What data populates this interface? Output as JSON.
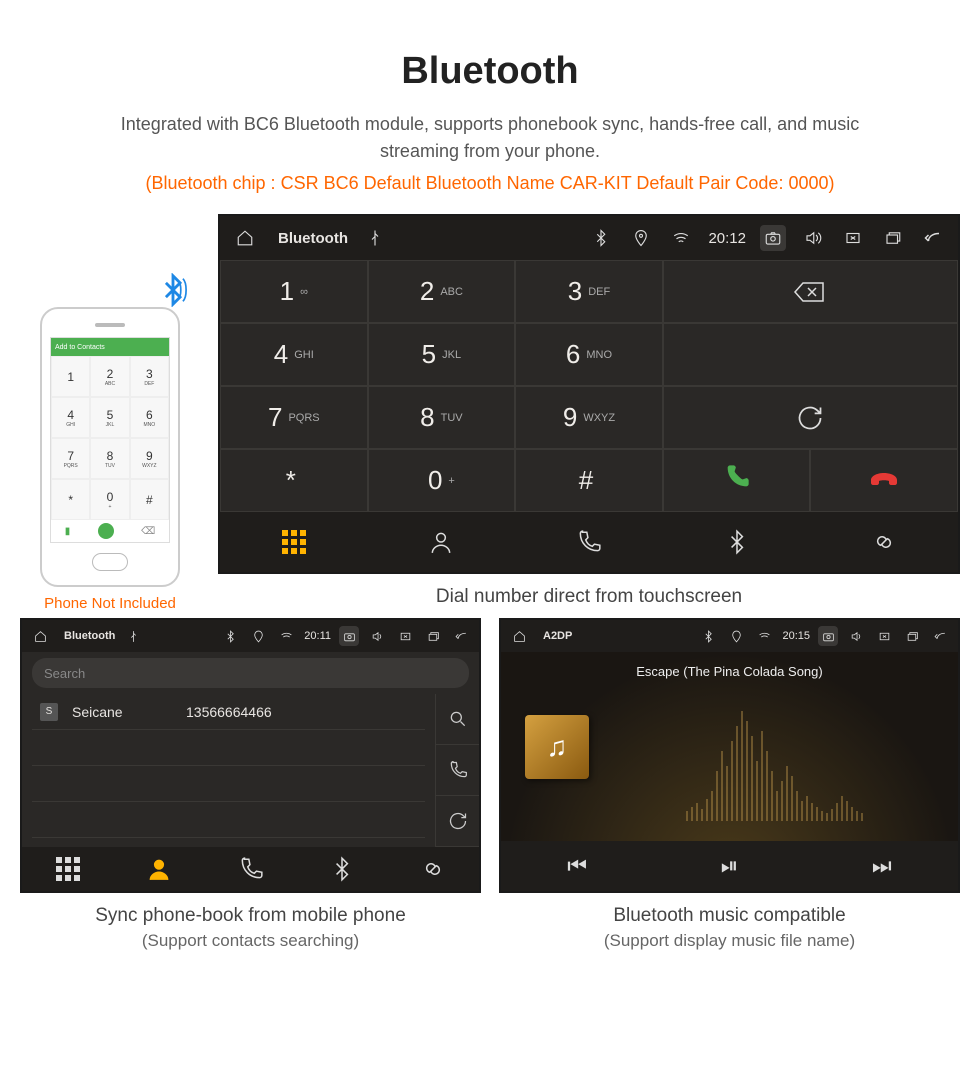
{
  "header": {
    "title": "Bluetooth",
    "subtitle": "Integrated with BC6 Bluetooth module, supports phonebook sync, hands-free call, and music streaming from your phone.",
    "specline": "(Bluetooth chip : CSR BC6    Default Bluetooth Name CAR-KIT    Default Pair Code: 0000)"
  },
  "phone_mock": {
    "topbar_label": "Add to Contacts",
    "caption": "Phone Not Included",
    "keys": [
      {
        "n": "1",
        "l": ""
      },
      {
        "n": "2",
        "l": "ABC"
      },
      {
        "n": "3",
        "l": "DEF"
      },
      {
        "n": "4",
        "l": "GHI"
      },
      {
        "n": "5",
        "l": "JKL"
      },
      {
        "n": "6",
        "l": "MNO"
      },
      {
        "n": "7",
        "l": "PQRS"
      },
      {
        "n": "8",
        "l": "TUV"
      },
      {
        "n": "9",
        "l": "WXYZ"
      },
      {
        "n": "*",
        "l": ""
      },
      {
        "n": "0",
        "l": "+"
      },
      {
        "n": "#",
        "l": ""
      }
    ]
  },
  "main_panel": {
    "status": {
      "title": "Bluetooth",
      "time": "20:12"
    },
    "keys": [
      {
        "d": "1",
        "l": "∞"
      },
      {
        "d": "2",
        "l": "ABC"
      },
      {
        "d": "3",
        "l": "DEF"
      },
      {
        "d": "4",
        "l": "GHI"
      },
      {
        "d": "5",
        "l": "JKL"
      },
      {
        "d": "6",
        "l": "MNO"
      },
      {
        "d": "7",
        "l": "PQRS"
      },
      {
        "d": "8",
        "l": "TUV"
      },
      {
        "d": "9",
        "l": "WXYZ"
      },
      {
        "d": "*",
        "l": ""
      },
      {
        "d": "0",
        "l": "+"
      },
      {
        "d": "#",
        "l": ""
      }
    ],
    "caption": "Dial number direct from touchscreen"
  },
  "phonebook_panel": {
    "status": {
      "title": "Bluetooth",
      "time": "20:11"
    },
    "search_placeholder": "Search",
    "contacts": [
      {
        "badge": "S",
        "name": "Seicane",
        "number": "13566664466"
      }
    ],
    "caption_line1": "Sync phone-book from mobile phone",
    "caption_line2": "(Support contacts searching)"
  },
  "music_panel": {
    "status": {
      "title": "A2DP",
      "time": "20:15"
    },
    "song": "Escape (The Pina Colada Song)",
    "caption_line1": "Bluetooth music compatible",
    "caption_line2": "(Support display music file name)"
  }
}
